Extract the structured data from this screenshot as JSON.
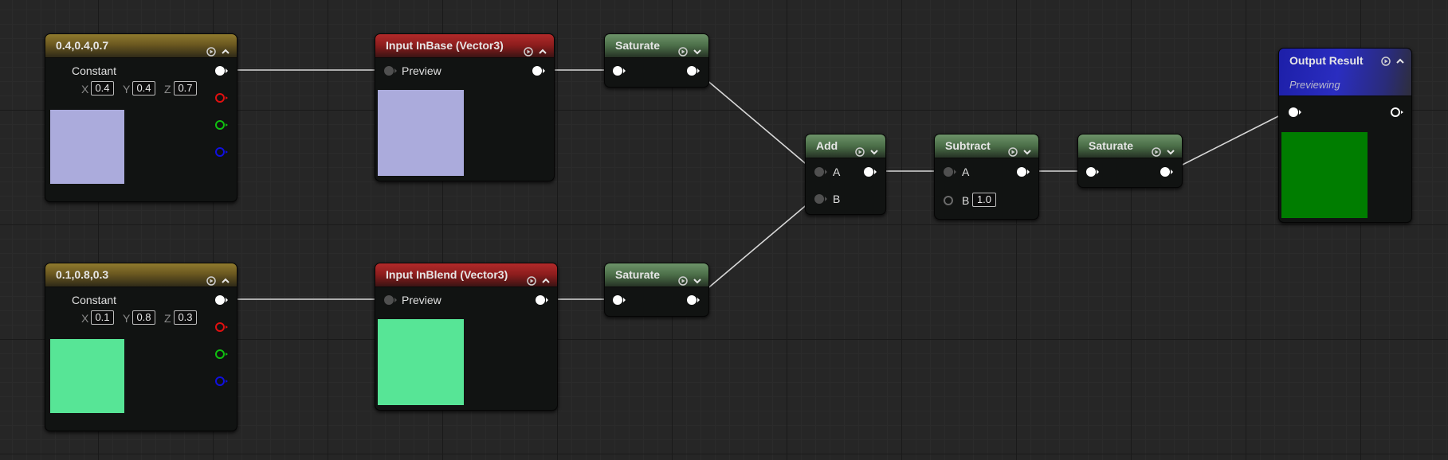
{
  "nodes": {
    "const_a": {
      "title": "0.4,0.4,0.7",
      "label": "Constant",
      "x_axis": "X",
      "y_axis": "Y",
      "z_axis": "Z",
      "x": "0.4",
      "y": "0.4",
      "z": "0.7"
    },
    "const_b": {
      "title": "0.1,0.8,0.3",
      "label": "Constant",
      "x_axis": "X",
      "y_axis": "Y",
      "z_axis": "Z",
      "x": "0.1",
      "y": "0.8",
      "z": "0.3"
    },
    "input_base": {
      "title": "Input InBase (Vector3)",
      "pin_label": "Preview"
    },
    "input_blend": {
      "title": "Input InBlend (Vector3)",
      "pin_label": "Preview"
    },
    "saturate_1": {
      "title": "Saturate"
    },
    "saturate_2": {
      "title": "Saturate"
    },
    "saturate_3": {
      "title": "Saturate"
    },
    "add": {
      "title": "Add",
      "pin_a": "A",
      "pin_b": "B"
    },
    "subtract": {
      "title": "Subtract",
      "pin_a": "A",
      "pin_b": "B",
      "b_value": "1.0"
    },
    "output": {
      "title": "Output Result",
      "subtitle": "Previewing"
    }
  },
  "icons": {
    "preview_toggle": "play-circle-icon",
    "collapse": "chevron-up-icon",
    "expand": "chevron-down-icon"
  },
  "colors": {
    "const_a_preview": "#ababdc",
    "const_b_preview": "#57e596",
    "output_preview": "#007d00",
    "constant_header": "#8f7a2e",
    "input_header": "#b22a2a",
    "function_header": "#6d9369",
    "output_header": "#1d1fa8"
  }
}
